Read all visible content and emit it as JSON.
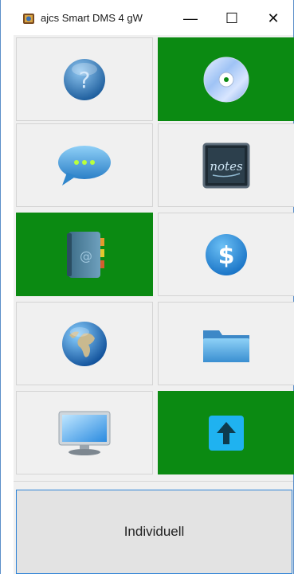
{
  "window": {
    "title": "ajcs Smart DMS 4 gW",
    "controls": {
      "minimize": "—",
      "maximize": "☐",
      "close": "✕"
    }
  },
  "tiles": [
    {
      "name": "help",
      "icon": "question-icon",
      "active": false
    },
    {
      "name": "disc",
      "icon": "cd-disc-icon",
      "active": true
    },
    {
      "name": "chat",
      "icon": "chat-bubble-icon",
      "active": false
    },
    {
      "name": "notes",
      "icon": "notes-icon",
      "active": false,
      "icon_text": "notes"
    },
    {
      "name": "address-book",
      "icon": "address-book-icon",
      "active": true,
      "icon_text": "@"
    },
    {
      "name": "dollar",
      "icon": "dollar-icon",
      "active": false,
      "icon_text": "$"
    },
    {
      "name": "globe",
      "icon": "globe-icon",
      "active": false
    },
    {
      "name": "folder",
      "icon": "folder-icon",
      "active": false
    },
    {
      "name": "monitor",
      "icon": "monitor-icon",
      "active": false
    },
    {
      "name": "upload",
      "icon": "up-arrow-icon",
      "active": true
    }
  ],
  "bottom_button": {
    "label": "Individuell"
  },
  "colors": {
    "active_tile": "#0b8a12",
    "tile": "#f0f0f0",
    "focus_border": "#2e83d6"
  }
}
